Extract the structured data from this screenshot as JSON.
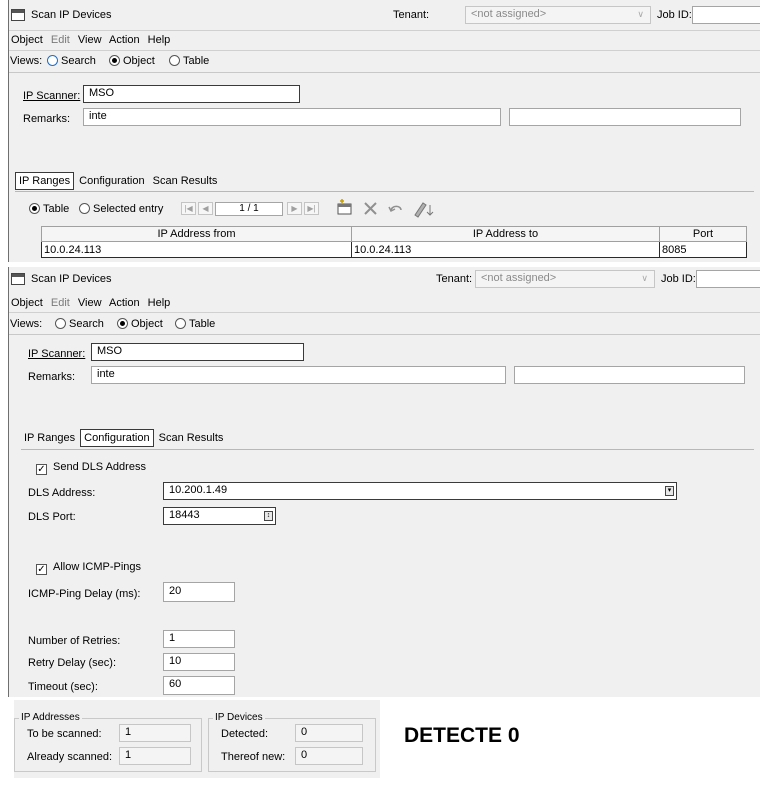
{
  "window": {
    "title": "Scan IP Devices",
    "tenant_label": "Tenant:",
    "tenant_value": "<not assigned>",
    "job_id_label": "Job ID:"
  },
  "menu": [
    "Object",
    "Edit",
    "View",
    "Action",
    "Help"
  ],
  "views": {
    "label": "Views:",
    "options": [
      "Search",
      "Object",
      "Table"
    ],
    "selected": "Object"
  },
  "form": {
    "ip_scanner_label": "IP Scanner:",
    "ip_scanner_value": "MSO",
    "remarks_label": "Remarks:",
    "remarks_value": "inte"
  },
  "tabs": [
    "IP Ranges",
    "Configuration",
    "Scan Results"
  ],
  "ip_ranges": {
    "mode_options": [
      "Table",
      "Selected entry"
    ],
    "pager": "1 / 1",
    "columns": [
      "IP Address from",
      "IP Address to",
      "Port"
    ],
    "rows": [
      {
        "from": "10.0.24.113",
        "to": "10.0.24.113",
        "port": "8085"
      }
    ]
  },
  "configuration": {
    "send_dls_label": "Send DLS Address",
    "send_dls_checked": true,
    "dls_address_label": "DLS Address:",
    "dls_address_value": "10.200.1.49",
    "dls_port_label": "DLS Port:",
    "dls_port_value": "18443",
    "allow_icmp_label": "Allow ICMP-Pings",
    "allow_icmp_checked": true,
    "icmp_delay_label": "ICMP-Ping Delay (ms):",
    "icmp_delay_value": "20",
    "retries_label": "Number of Retries:",
    "retries_value": "1",
    "retry_delay_label": "Retry Delay (sec):",
    "retry_delay_value": "10",
    "timeout_label": "Timeout (sec):",
    "timeout_value": "60"
  },
  "scan_summary": {
    "ip_addresses_title": "IP Addresses",
    "to_be_scanned_label": "To be scanned:",
    "to_be_scanned_value": "1",
    "already_scanned_label": "Already scanned:",
    "already_scanned_value": "1",
    "ip_devices_title": "IP Devices",
    "detected_label": "Detected:",
    "detected_value": "0",
    "thereof_new_label": "Thereof new:",
    "thereof_new_value": "0"
  },
  "annotation": "DETECTE 0"
}
